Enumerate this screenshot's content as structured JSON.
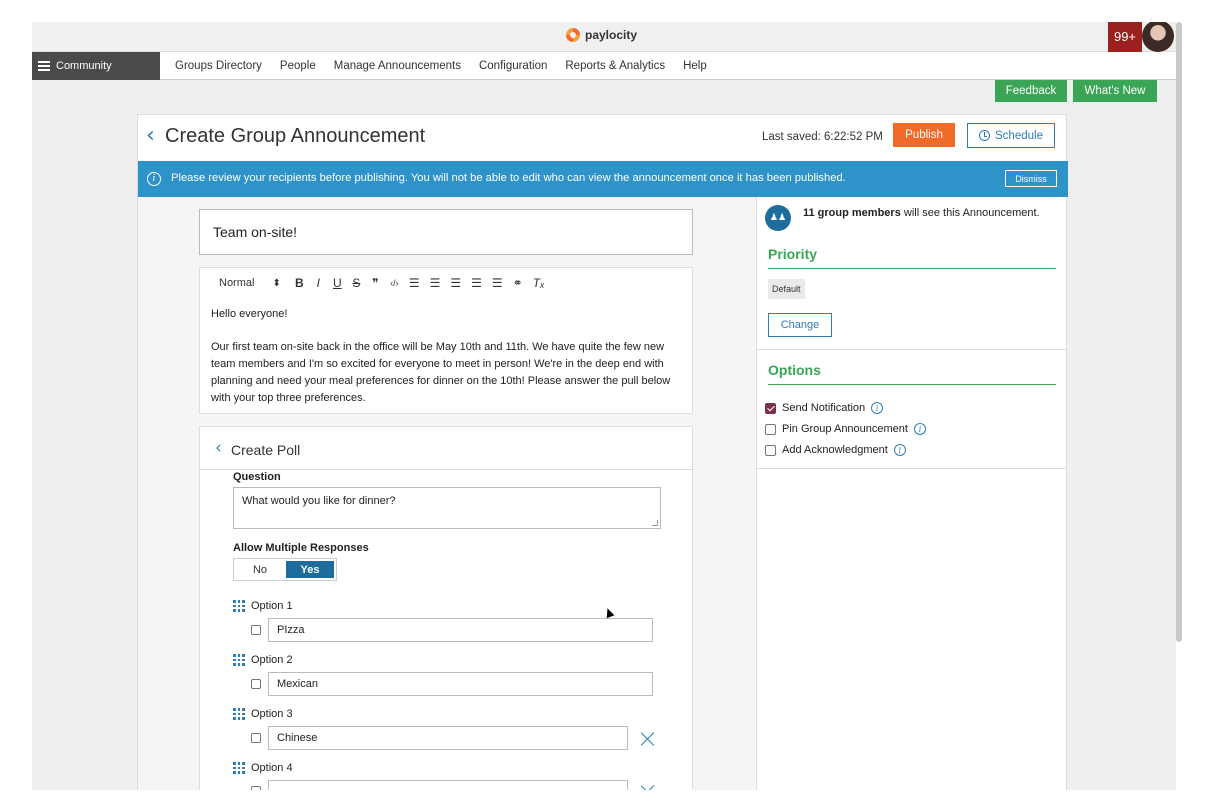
{
  "app": {
    "logo_text": "paylocity",
    "notifications": "99+",
    "brand_colors": {
      "orange": "#f26a28",
      "blue": "#2c7fb8",
      "green": "#3aa655",
      "banner": "#2e93c8"
    }
  },
  "nav": {
    "community_label": "Community",
    "links": [
      "Groups Directory",
      "People",
      "Manage Announcements",
      "Configuration",
      "Reports & Analytics",
      "Help"
    ]
  },
  "utility": {
    "feedback_label": "Feedback",
    "whats_new_label": "What's New"
  },
  "header": {
    "title": "Create Group Announcement",
    "last_saved": "Last saved: 6:22:52 PM",
    "publish_label": "Publish",
    "schedule_label": "Schedule"
  },
  "banner": {
    "text": "Please review your recipients before publishing. You will not be able to edit who can view the announcement once it has been published.",
    "dismiss_label": "Dismiss"
  },
  "editor": {
    "title_value": "Team on-site!",
    "format_select": "Normal",
    "toolbar_icons": [
      "bold-icon",
      "italic-icon",
      "underline-icon",
      "strikethrough-icon",
      "quote-icon",
      "code-icon",
      "ordered-list-icon",
      "bullet-list-icon",
      "align-icon",
      "outdent-icon",
      "indent-icon",
      "link-icon",
      "clear-format-icon"
    ],
    "toolbar_glyphs": [
      "B",
      "I",
      "U",
      "S",
      "❞",
      "‹/›",
      "☰",
      "☰",
      "☰",
      "☰",
      "☰",
      "⚭",
      "Tₓ"
    ],
    "paragraph_1": "Hello everyone!",
    "paragraph_2": "Our first team on-site back in the office will be May 10th and 11th. We have quite the few new team members and I'm so excited for everyone to meet in person! We're in the deep end with planning and need your meal preferences for dinner on the 10th! Please answer the pull below with your top three preferences."
  },
  "poll": {
    "title": "Create Poll",
    "question_label": "Question",
    "question_value": "What would you like for dinner?",
    "multiple_label": "Allow Multiple Responses",
    "toggle_no": "No",
    "toggle_yes": "Yes",
    "options": [
      {
        "label": "Option 1",
        "value": "PIzza"
      },
      {
        "label": "Option 2",
        "value": "Mexican"
      },
      {
        "label": "Option 3",
        "value": "Chinese"
      },
      {
        "label": "Option 4",
        "value": ""
      }
    ]
  },
  "sidebar": {
    "members_count": "11 group members",
    "members_suffix": " will see this Announcement.",
    "priority_heading": "Priority",
    "priority_value": "Default",
    "change_label": "Change",
    "options_heading": "Options",
    "send_notification": "Send Notification",
    "send_notification_checked": true,
    "pin_announcement": "Pin Group Announcement",
    "pin_announcement_checked": false,
    "add_ack": "Add Acknowledgment",
    "add_ack_checked": false
  }
}
